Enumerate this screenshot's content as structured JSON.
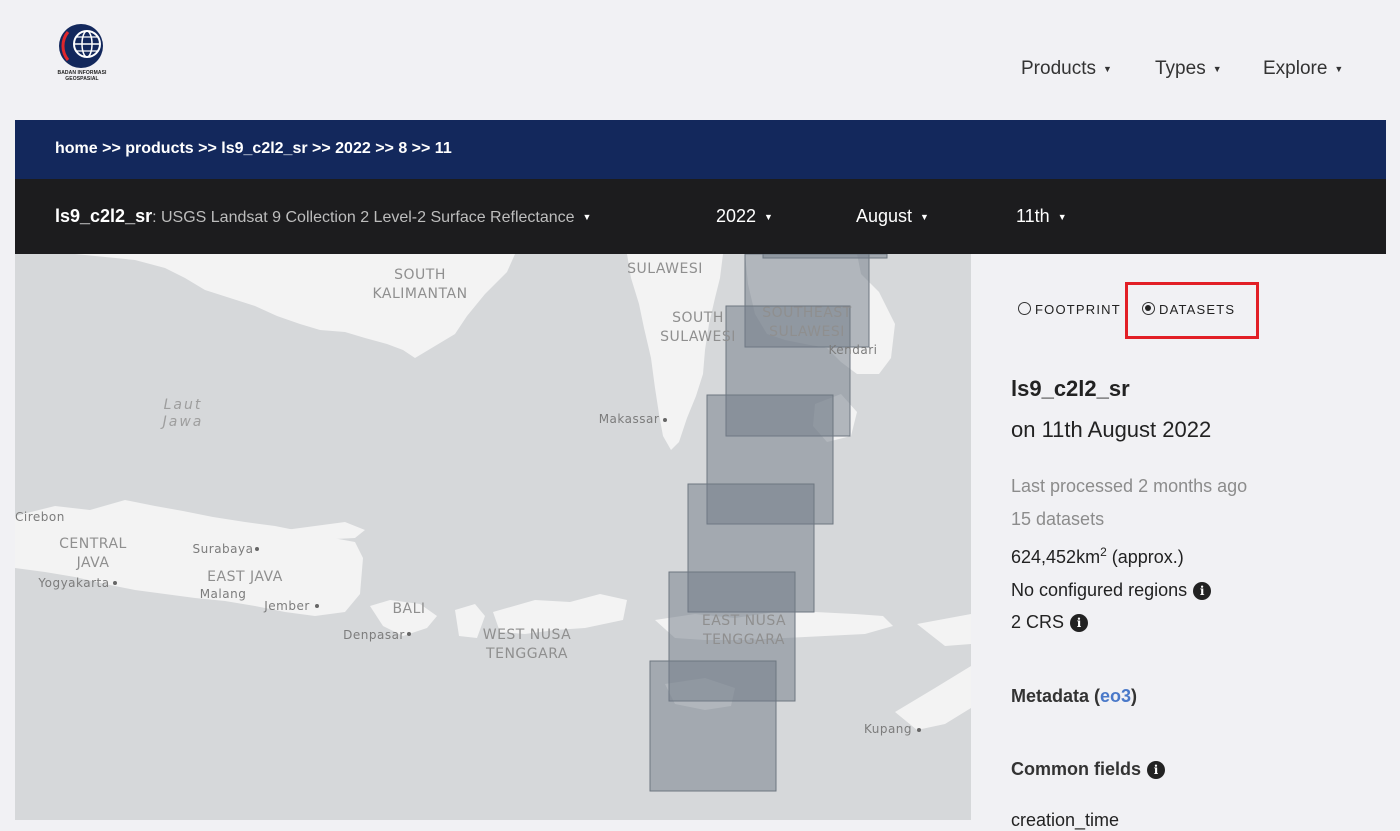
{
  "header": {
    "logo_text": "BADAN INFORMASI GEOSPASIAL",
    "nav": [
      "Products",
      "Types",
      "Explore"
    ]
  },
  "breadcrumb": "home >> products >> ls9_c2l2_sr >> 2022 >> 8 >> 11",
  "product_bar": {
    "product_name": "ls9_c2l2_sr",
    "product_desc": ": USGS Landsat 9 Collection 2 Level-2 Surface Reflectance",
    "year": "2022",
    "month": "August",
    "day": "11th"
  },
  "map_labels": {
    "south_kalimantan": "SOUTH\nKALIMANTAN",
    "sulawesi": "SULAWESI",
    "south_sulawesi": "SOUTH\nSULAWESI",
    "southeast_sulawesi": "SOUTHEAST\nSULAWESI",
    "kendari": "Kendari",
    "laut_jawa": "Laut\nJawa",
    "makassar": "Makassar",
    "cirebon": "Cirebon",
    "central_java": "CENTRAL\nJAVA",
    "surabaya": "Surabaya",
    "yogyakarta": "Yogyakarta",
    "east_java": "EAST JAVA",
    "malang": "Malang",
    "jember": "Jember",
    "bali": "BALI",
    "denpasar": "Denpasar",
    "west_nusa_tenggara": "WEST NUSA\nTENGGARA",
    "east_nusa_tenggara": "EAST NUSA\nTENGGARA",
    "kupang": "Kupang"
  },
  "panel": {
    "radio_footprint": "FOOTPRINT",
    "radio_datasets": "DATASETS",
    "selected_radio": "datasets",
    "title": "ls9_c2l2_sr",
    "date_text": "on 11th August 2022",
    "last_processed": "Last processed 2 months ago",
    "dataset_count": "15 datasets",
    "area_value": "624,452km",
    "area_sup": "2",
    "area_suffix": " (approx.)",
    "regions": "No configured regions",
    "crs": "2 CRS",
    "metadata_label": "Metadata (",
    "metadata_link": "eo3",
    "metadata_close": ")",
    "common_fields": "Common fields",
    "cut_off_field": "creation_time"
  },
  "colors": {
    "crumb_bar": "#13285c",
    "product_bar": "#1c1c1e",
    "highlight": "#e21f26",
    "link": "#4a79c9"
  }
}
